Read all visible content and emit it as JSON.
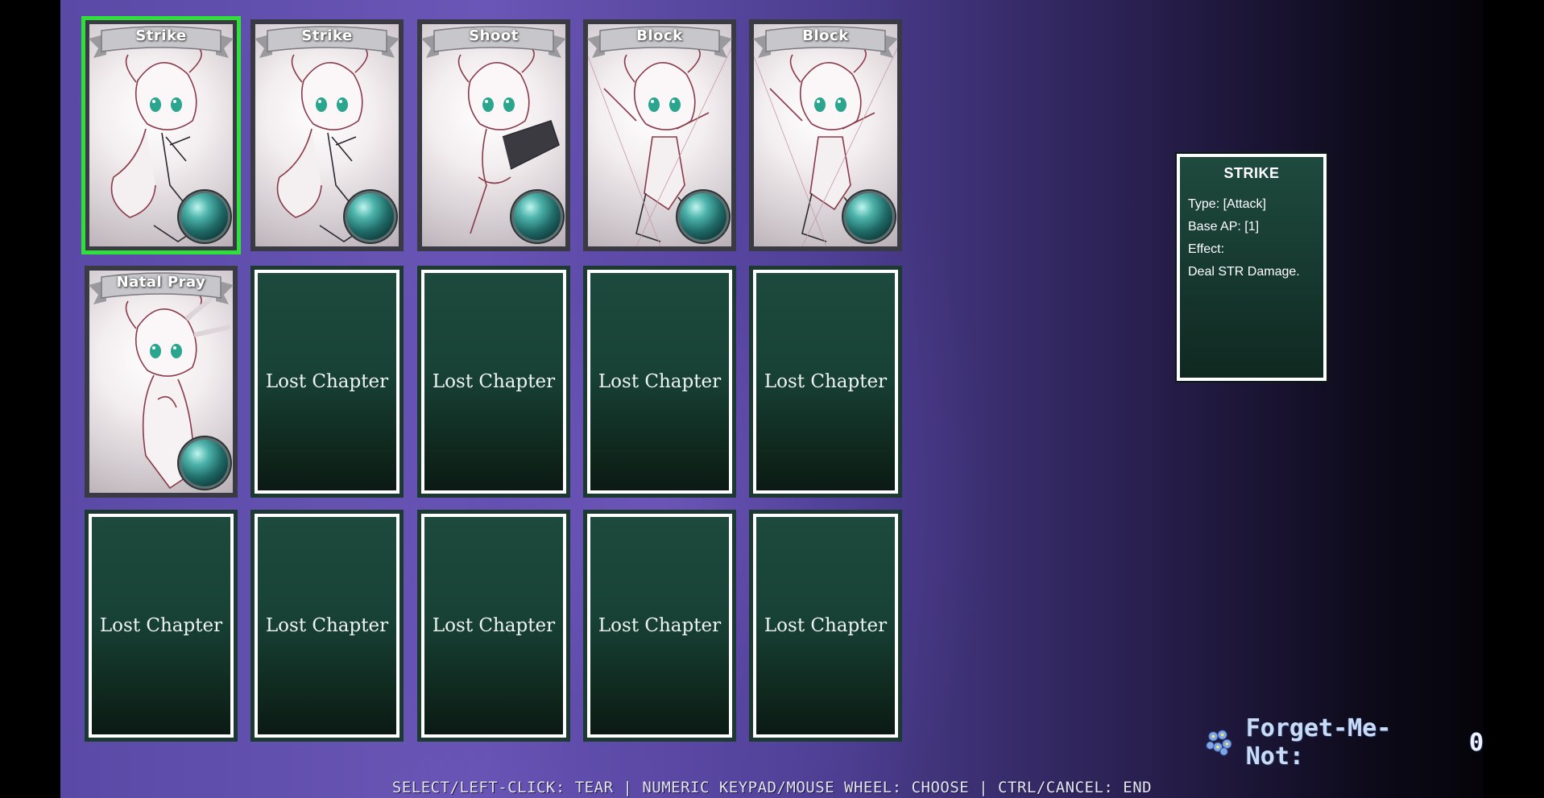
{
  "cards": [
    {
      "type": "art",
      "title": "Strike",
      "selected": true,
      "pose": "punch"
    },
    {
      "type": "art",
      "title": "Strike",
      "selected": false,
      "pose": "punch"
    },
    {
      "type": "art",
      "title": "Shoot",
      "selected": false,
      "pose": "kick"
    },
    {
      "type": "art",
      "title": "Block",
      "selected": false,
      "pose": "guard"
    },
    {
      "type": "art",
      "title": "Block",
      "selected": false,
      "pose": "guard"
    },
    {
      "type": "art",
      "title": "Natal Pray",
      "selected": false,
      "pose": "pray"
    },
    {
      "type": "lost",
      "label": "Lost Chapter"
    },
    {
      "type": "lost",
      "label": "Lost Chapter"
    },
    {
      "type": "lost",
      "label": "Lost Chapter"
    },
    {
      "type": "lost",
      "label": "Lost Chapter"
    },
    {
      "type": "lost",
      "label": "Lost Chapter"
    },
    {
      "type": "lost",
      "label": "Lost Chapter"
    },
    {
      "type": "lost",
      "label": "Lost Chapter"
    },
    {
      "type": "lost",
      "label": "Lost Chapter"
    },
    {
      "type": "lost",
      "label": "Lost Chapter"
    }
  ],
  "info_panel": {
    "title": "STRIKE",
    "type_line": "Type: [Attack]",
    "ap_line": "Base AP: [1]",
    "effect_label": "Effect:",
    "effect_text": "Deal STR Damage."
  },
  "forget_me_not": {
    "label": "Forget-Me-Not:",
    "value": "0",
    "icon": "forget-me-not-flower-icon"
  },
  "controls_hint": "SELECT/LEFT-CLICK: TEAR | NUMERIC KEYPAD/MOUSE WHEEL: CHOOSE | CTRL/CANCEL: END",
  "colors": {
    "selection": "#2fe03a",
    "card_green": "#1d4a3d",
    "background_purple": "#6a56b6"
  }
}
